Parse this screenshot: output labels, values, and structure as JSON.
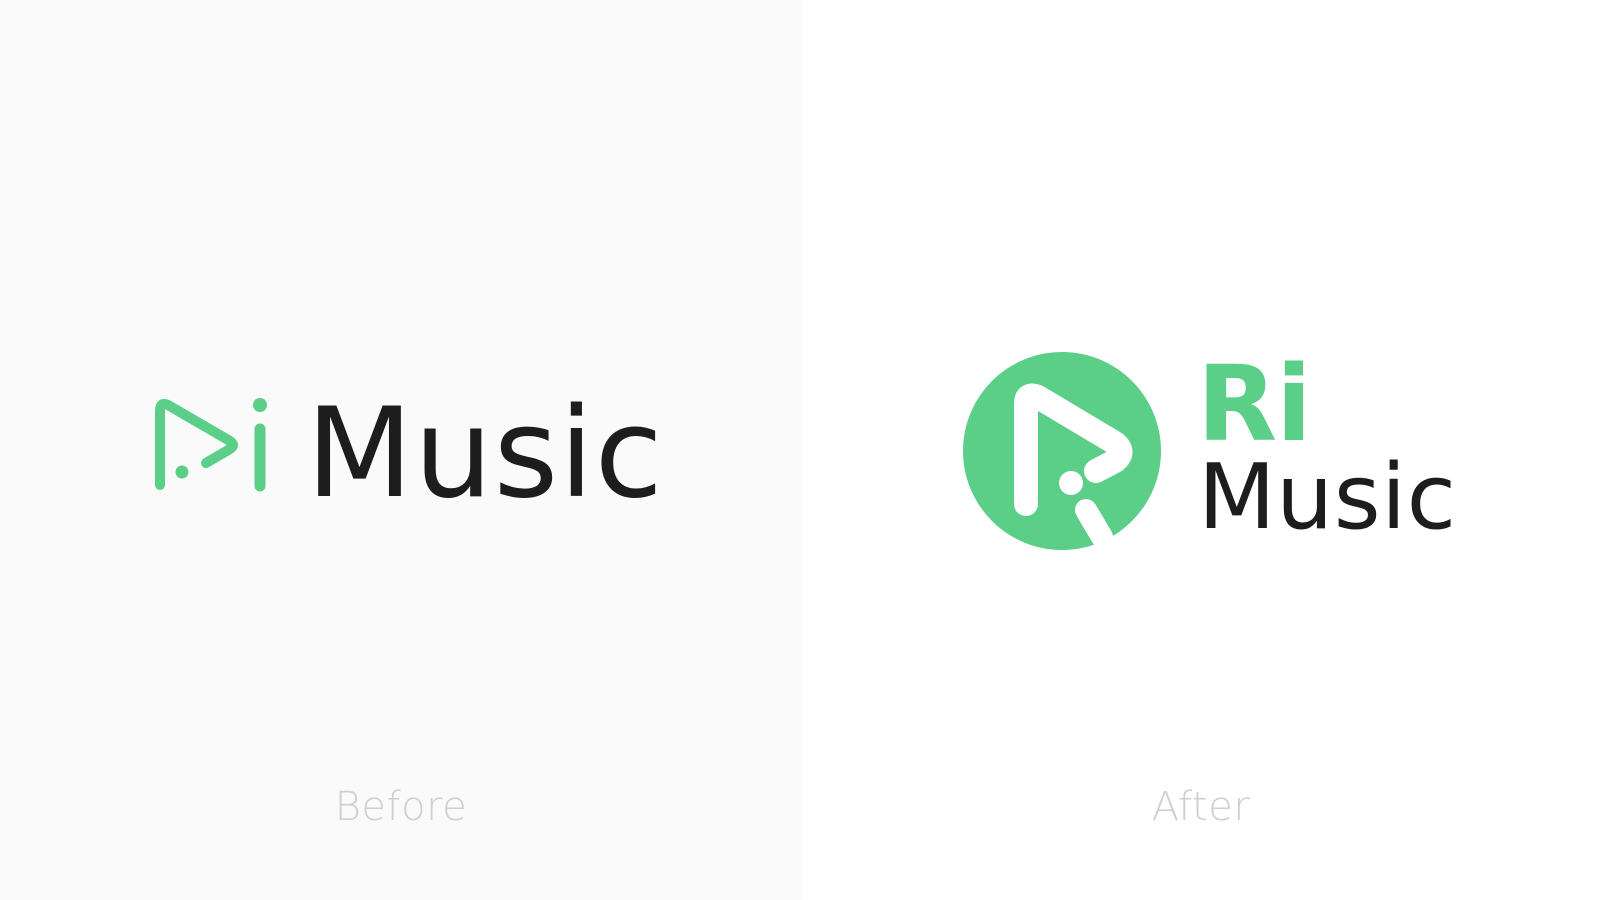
{
  "colors": {
    "brand_green": "#5bce87",
    "text_dark": "#1d1d1d",
    "caption_gray": "#cfcfcf",
    "panel_before_bg": "#fafafa",
    "panel_after_bg": "#ffffff"
  },
  "before": {
    "caption": "Before",
    "logo_icon": "play-i-outline-icon",
    "logo_wordmark": "Music"
  },
  "after": {
    "caption": "After",
    "logo_icon": "play-circle-badge-icon",
    "logo_ri": "Ri",
    "logo_wordmark": "Music"
  }
}
